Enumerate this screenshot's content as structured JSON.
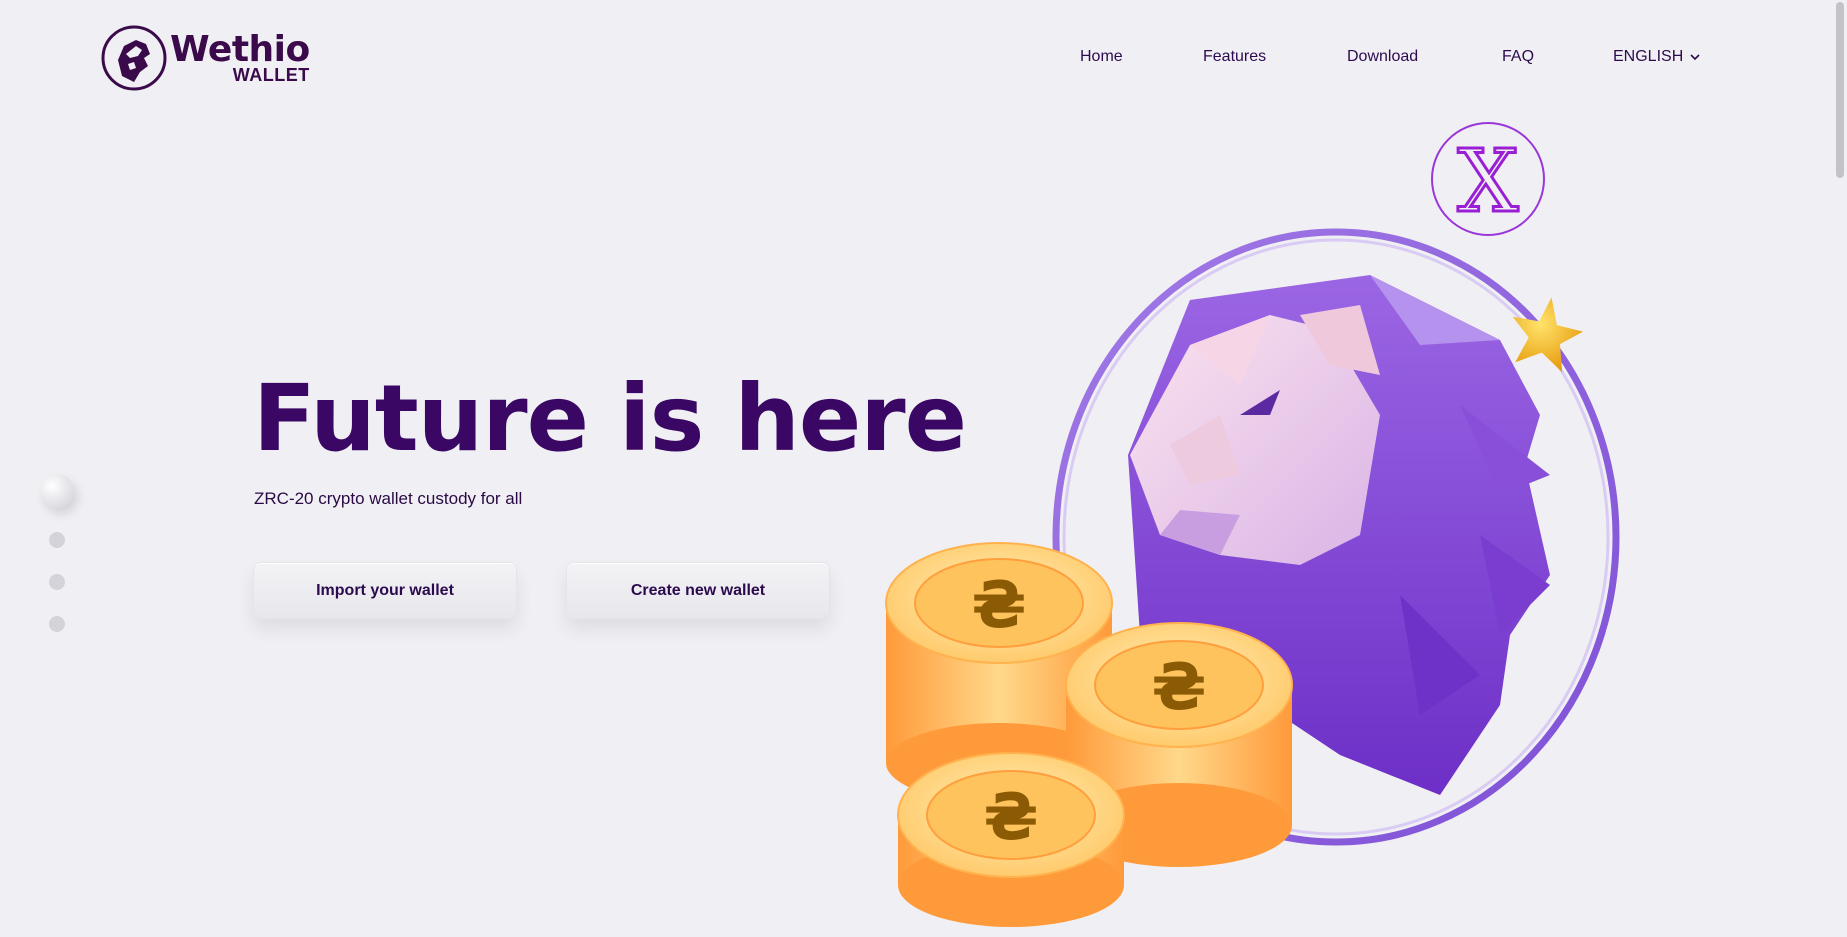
{
  "brand": {
    "name": "Wethio",
    "sub": "WALLET",
    "logo_icon": "lion-head-icon"
  },
  "nav": {
    "items": [
      {
        "label": "Home"
      },
      {
        "label": "Features"
      },
      {
        "label": "Download"
      },
      {
        "label": "FAQ"
      }
    ],
    "language": {
      "label": "ENGLISH",
      "icon": "chevron-down-icon"
    }
  },
  "slider": {
    "count": 4,
    "active": 1
  },
  "hero": {
    "title": "Future is here",
    "subtitle": "ZRC-20 crypto wallet custody for all",
    "buttons": {
      "import": "Import your wallet",
      "create": "Create new wallet"
    }
  },
  "illustration": {
    "badge_letter": "X",
    "icons": [
      "lion-illustration",
      "x-badge-icon",
      "star-icon",
      "coin-stack-icon"
    ]
  },
  "colors": {
    "background": "#f0f0f4",
    "title": "#3a0764",
    "purple": "#8a4fd8",
    "gold": "#f7a823"
  }
}
